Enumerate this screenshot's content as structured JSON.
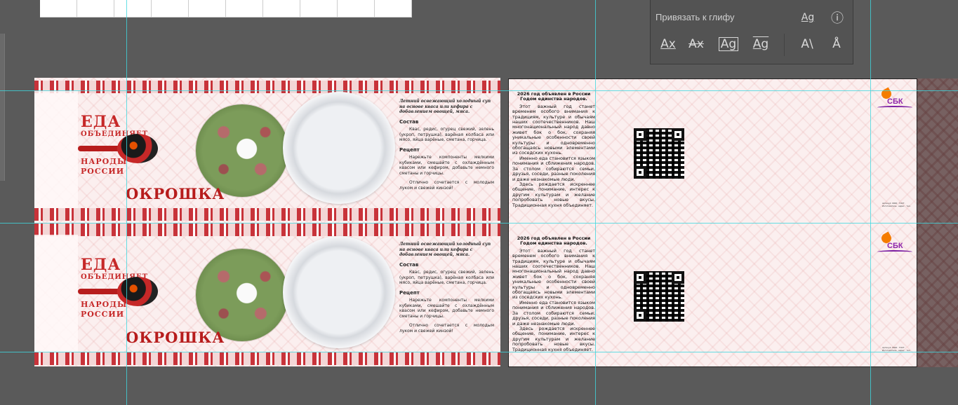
{
  "panel": {
    "title": "Привязать к глифу",
    "buttons": [
      "Ag",
      "ⓘ",
      "Ax",
      "Ax",
      "Ag",
      "Ag",
      "A\\",
      "Å"
    ]
  },
  "label": {
    "eda": "ЕДА",
    "obedinyaet": "ОБЪЕДИНЯЕТ",
    "narody": "НАРОДЫ",
    "rossii": "РОССИИ",
    "title": "ОКРОШКА",
    "lead": "Летний освежающий холодный суп на основе кваса или кефира с добавлением овощей, мяса.",
    "composition_head": "Состав",
    "composition": "Квас, редис, огурец свежий, зелень (укроп, петрушка), варёная колбаса или мясо, яйца варёные, сметана, горчица.",
    "recipe_head": "Рецепт",
    "recipe": "Нарежьте компоненты мелкими кубиками, смешайте с охлаждённым квасом или кефиром, добавьте немного сметаны и горчицы.",
    "serving": "Отлично сочетается с молодым луком и свежей кинзой!"
  },
  "info": {
    "header": "2026 год объявлен в России Годом единства народов.",
    "p1": "Этот важный год станет временем особого внимания к традициям, культуре и обычаям наших соотечественников. Наш многонациональный народ давно живет бок о бок, сохраняя уникальные особенности своей культуры и одновременно обогащаясь новыми элементами из соседских кухонь.",
    "p2": "Именно еда становится языком понимания и сближения народов. За столом собираются семьи, друзья, соседи, разные поколения и даже незнакомые люди.",
    "p3": "Здесь рождается искреннее общение, понимание, интерес к другим культурам и желание попробовать новые вкусы. Традиционная кухня объединяет.",
    "logo": "СБК",
    "small": "Артикул: 0000 · ГОСТ · Изготовитель · адрес · тел."
  }
}
